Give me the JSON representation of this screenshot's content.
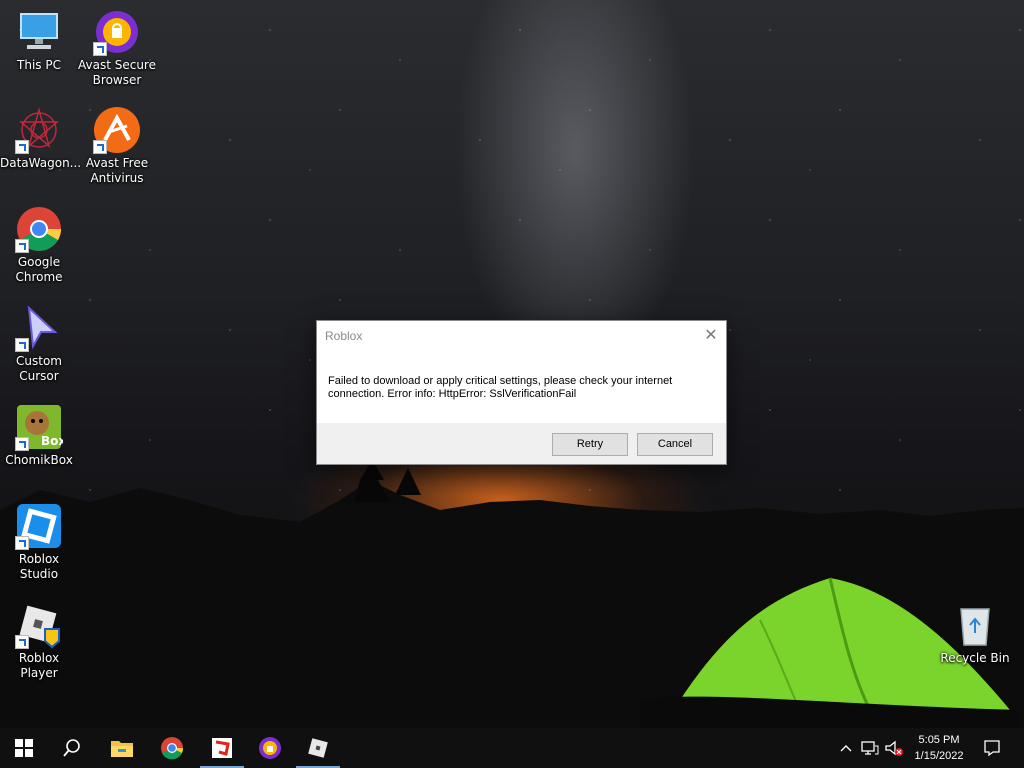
{
  "desktop_icons": [
    {
      "id": "this-pc",
      "label": "This PC"
    },
    {
      "id": "avast-secure-browser",
      "label": "Avast Secure Browser"
    },
    {
      "id": "datawagon",
      "label": "DataWagon..."
    },
    {
      "id": "avast-free-antivirus",
      "label": "Avast Free Antivirus"
    },
    {
      "id": "google-chrome",
      "label": "Google Chrome"
    },
    {
      "id": "custom-cursor",
      "label": "Custom Cursor"
    },
    {
      "id": "chomikbox",
      "label": "ChomikBox"
    },
    {
      "id": "roblox-studio",
      "label": "Roblox Studio"
    },
    {
      "id": "roblox-player",
      "label": "Roblox Player"
    },
    {
      "id": "recycle-bin",
      "label": "Recycle Bin"
    }
  ],
  "dialog": {
    "title": "Roblox",
    "close_glyph": "✕",
    "message_line1": "Failed to download or apply critical settings, please check your internet",
    "message_line2": "connection. Error info: HttpError: SslVerificationFail",
    "retry_label": "Retry",
    "cancel_label": "Cancel"
  },
  "taskbar": {
    "pinned": [
      "start-icon",
      "search-icon",
      "file-explorer-icon",
      "chrome-icon",
      "roblox-studio-icon",
      "avast-browser-icon",
      "roblox-player-icon"
    ],
    "active": [
      "roblox-studio-icon",
      "roblox-player-icon"
    ],
    "time": "5:05 PM",
    "date": "1/15/2022"
  },
  "colors": {
    "taskbar_bg": "#101010",
    "dialog_footer": "#f0f0f0",
    "accent": "#7aa6d6"
  }
}
